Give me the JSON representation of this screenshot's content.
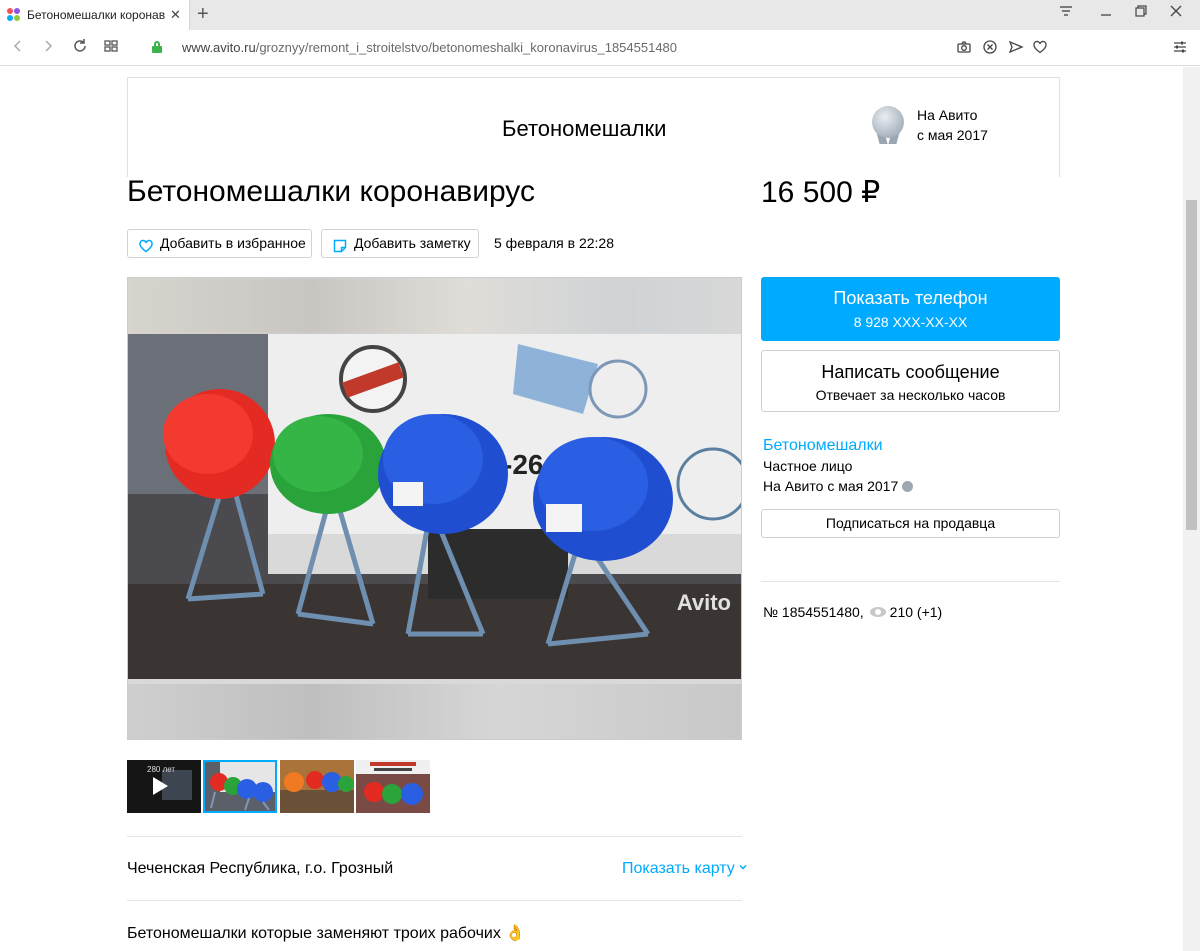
{
  "browser": {
    "tab_title": "Бетономешалки коронав",
    "tab_close": "✕",
    "new_tab": "+",
    "url_host": "www.avito.ru",
    "url_path": "/groznyy/remont_i_stroitelstvo/betonomeshalki_koronavirus_1854551480"
  },
  "shop": {
    "name": "Бетономешалки",
    "since_line1": "На Авито",
    "since_line2": "с мая 2017"
  },
  "ad": {
    "title": "Бетономешалки коронавирус",
    "price": "16 500 ₽",
    "favorite_label": "Добавить в избранное",
    "note_label": "Добавить заметку",
    "date": "5 февраля в 22:28",
    "watermark": "Avito",
    "location": "Чеченская Республика, г.о. Грозный",
    "show_map": "Показать карту",
    "description": "Бетономешалки которые заменяют троих рабочих 👌"
  },
  "sidebar": {
    "phone_label": "Показать телефон",
    "phone_number": "8 928 XXX-XX-XX",
    "message_label": "Написать сообщение",
    "message_sub": "Отвечает за несколько часов",
    "seller_name": "Бетономешалки",
    "seller_type": "Частное лицо",
    "seller_since": "На Авито с мая 2017",
    "subscribe_label": "Подписаться на продавца",
    "ad_number": "№ 1854551480,",
    "views": "210 (+1)"
  },
  "thumbs": [
    {
      "name": "video",
      "active": false
    },
    {
      "name": "mixers-1",
      "active": true
    },
    {
      "name": "mixers-2",
      "active": false
    },
    {
      "name": "mixers-3",
      "active": false
    }
  ],
  "colors": {
    "accent": "#00aaff",
    "lock": "#3cb449"
  }
}
